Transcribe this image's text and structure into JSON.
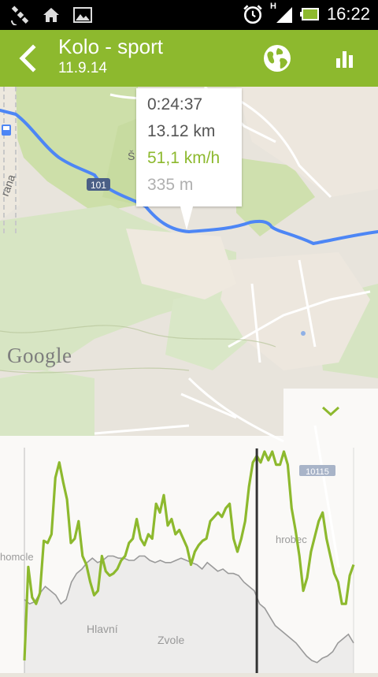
{
  "status_bar": {
    "time": "16:22",
    "signal_label": "H",
    "left_icons": [
      "satellite-icon",
      "home-icon",
      "image-icon"
    ],
    "right_icons": [
      "alarm-icon",
      "signal-icon",
      "battery-icon"
    ]
  },
  "app_bar": {
    "title": "Kolo - sport",
    "subtitle": "11.9.14",
    "actions": [
      "globe-icon",
      "stats-icon"
    ]
  },
  "map": {
    "road_number_1": "101",
    "road_number_2": "10115",
    "label_s": "Š",
    "label_rana": "rana",
    "label_hlavni": "Hlavní",
    "label_zvole": "Zvole",
    "label_homole": "homole",
    "label_hrobec": "hrobec",
    "attribution": "Google"
  },
  "popup": {
    "time": "0:24:37",
    "distance": "13.12 km",
    "speed": "51,1 km/h",
    "elevation": "335 m",
    "colors": {
      "speed": "#8db92e",
      "elevation": "#b0b0b0",
      "default": "#555555"
    }
  },
  "colors": {
    "accent": "#8db92e",
    "route": "#4d86f5"
  },
  "chart_data": {
    "type": "line",
    "marker_fraction": 0.706,
    "series": [
      {
        "kind": "speed",
        "color": "#8db92e",
        "values": [
          0.04,
          0.47,
          0.33,
          0.3,
          0.35,
          0.59,
          0.58,
          0.62,
          0.88,
          0.95,
          0.86,
          0.78,
          0.58,
          0.6,
          0.68,
          0.52,
          0.48,
          0.4,
          0.34,
          0.36,
          0.52,
          0.45,
          0.43,
          0.44,
          0.46,
          0.5,
          0.52,
          0.58,
          0.6,
          0.69,
          0.6,
          0.57,
          0.62,
          0.6,
          0.76,
          0.72,
          0.8,
          0.66,
          0.69,
          0.62,
          0.64,
          0.6,
          0.56,
          0.48,
          0.54,
          0.57,
          0.59,
          0.6,
          0.68,
          0.7,
          0.72,
          0.7,
          0.74,
          0.76,
          0.6,
          0.54,
          0.6,
          0.68,
          0.84,
          0.95,
          0.98,
          0.95,
          1.0,
          0.96,
          1.0,
          0.94,
          0.94,
          1.0,
          0.94,
          0.74,
          0.64,
          0.52,
          0.36,
          0.42,
          0.54,
          0.61,
          0.68,
          0.72,
          0.6,
          0.52,
          0.44,
          0.4,
          0.3,
          0.3,
          0.43,
          0.48
        ]
      },
      {
        "kind": "elevation",
        "color": "#9a9a9a",
        "values": [
          0.32,
          0.3,
          0.31,
          0.35,
          0.38,
          0.36,
          0.34,
          0.3,
          0.32,
          0.4,
          0.44,
          0.46,
          0.49,
          0.51,
          0.49,
          0.5,
          0.52,
          0.52,
          0.51,
          0.51,
          0.5,
          0.5,
          0.52,
          0.52,
          0.5,
          0.49,
          0.5,
          0.49,
          0.49,
          0.5,
          0.51,
          0.5,
          0.49,
          0.48,
          0.46,
          0.49,
          0.47,
          0.45,
          0.46,
          0.44,
          0.44,
          0.43,
          0.4,
          0.38,
          0.36,
          0.3,
          0.28,
          0.24,
          0.2,
          0.18,
          0.16,
          0.14,
          0.12,
          0.09,
          0.06,
          0.04,
          0.03,
          0.05,
          0.06,
          0.08,
          0.12,
          0.14,
          0.16,
          0.12
        ]
      }
    ]
  }
}
